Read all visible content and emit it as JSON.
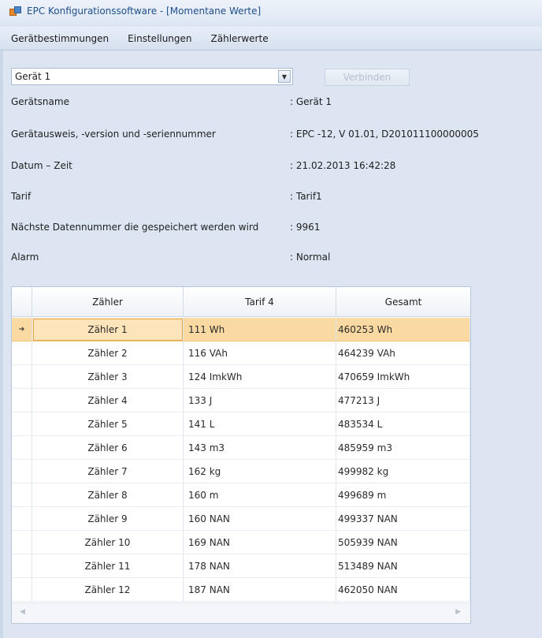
{
  "window": {
    "title": "EPC Konfigurationssoftware - [Momentane Werte]"
  },
  "menu": {
    "items": [
      "Gerätbestimmungen",
      "Einstellungen",
      "Zählerwerte"
    ]
  },
  "device": {
    "selected": "Gerät 1",
    "connect_label": "Verbinden"
  },
  "info": [
    {
      "label": "Gerätsname",
      "value": ": Gerät 1"
    },
    {
      "label": "Gerätausweis, -version und -seriennummer",
      "value": ": EPC -12, V 01.01, D201011100000005"
    },
    {
      "label": "Datum – Zeit",
      "value": ": 21.02.2013 16:42:28"
    },
    {
      "label": "Tarif",
      "value": ": Tarif1"
    },
    {
      "label": "Nächste Datennummer die gespeichert werden wird",
      "value": ": 9961"
    },
    {
      "label": "Alarm",
      "value": ": Normal"
    }
  ],
  "table": {
    "columns": [
      "Zähler",
      "Tarif 4",
      "Gesamt"
    ],
    "rows": [
      {
        "name": "Zähler 1",
        "tarif": "111 Wh",
        "gesamt": "460253  Wh"
      },
      {
        "name": "Zähler 2",
        "tarif": "116 VAh",
        "gesamt": "464239  VAh"
      },
      {
        "name": "Zähler 3",
        "tarif": "124 ImkWh",
        "gesamt": "470659  ImkWh"
      },
      {
        "name": "Zähler 4",
        "tarif": "133 J",
        "gesamt": "477213  J"
      },
      {
        "name": "Zähler 5",
        "tarif": "141 L",
        "gesamt": "483534  L"
      },
      {
        "name": "Zähler 6",
        "tarif": "143 m3",
        "gesamt": "485959  m3"
      },
      {
        "name": "Zähler 7",
        "tarif": "162 kg",
        "gesamt": "499982  kg"
      },
      {
        "name": "Zähler 8",
        "tarif": "160 m",
        "gesamt": "499689  m"
      },
      {
        "name": "Zähler 9",
        "tarif": "160 NAN",
        "gesamt": "499337  NAN"
      },
      {
        "name": "Zähler 10",
        "tarif": "169 NAN",
        "gesamt": "505939  NAN"
      },
      {
        "name": "Zähler 11",
        "tarif": "178 NAN",
        "gesamt": "513489  NAN"
      },
      {
        "name": "Zähler 12",
        "tarif": "187 NAN",
        "gesamt": "462050  NAN"
      }
    ],
    "selected_row": 0
  },
  "icons": {
    "app": "app-icon",
    "dropdown": "chevron-down-icon",
    "row_marker": "row-selector-icon",
    "scroll_left": "scroll-left-icon",
    "scroll_right": "scroll-right-icon"
  },
  "colors": {
    "title_text": "#1e4e8c",
    "selected_row": "#fbd9a2",
    "background": "#dce5f1"
  }
}
